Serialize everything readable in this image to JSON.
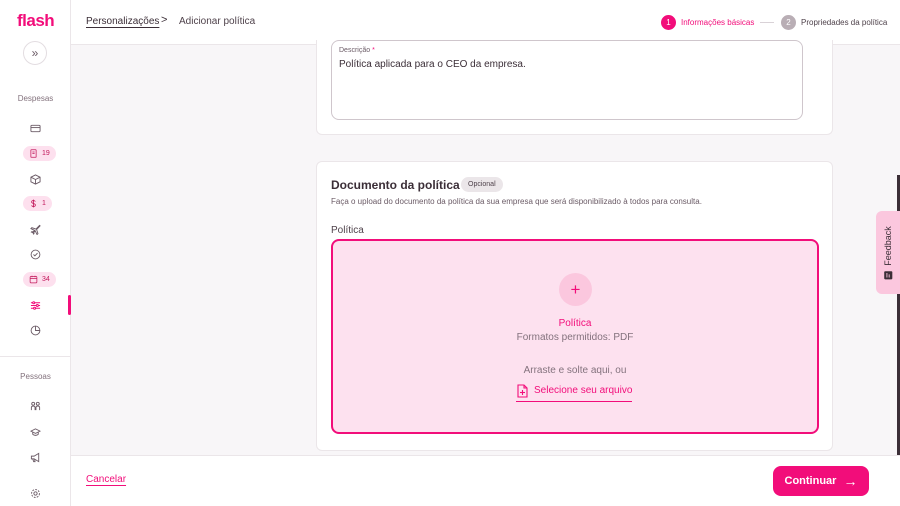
{
  "app": {
    "logo": "flash"
  },
  "sidebar": {
    "expand_glyph": "»",
    "section_expenses": "Despesas",
    "section_people": "Pessoas",
    "badges": {
      "reports": "19",
      "advances": "1",
      "approvals": "34"
    }
  },
  "breadcrumb": {
    "parent": "Personalizações",
    "separator": ">",
    "current": "Adicionar política"
  },
  "stepper": {
    "steps": [
      {
        "number": "1",
        "label": "Informações básicas",
        "active": true
      },
      {
        "number": "2",
        "label": "Propriedades da política",
        "active": false
      }
    ]
  },
  "description_field": {
    "label": "Descrição",
    "required_mark": "*",
    "value": "Política aplicada para o CEO da empresa."
  },
  "document_section": {
    "title": "Documento da política",
    "badge": "Opcional",
    "description": "Faça o upload do documento da política da sua empresa que será disponibilizado à todos para consulta.",
    "field_label": "Política",
    "dropzone": {
      "plus": "+",
      "title": "Política",
      "formats": "Formatos permitidos: PDF",
      "drag_text": "Arraste e solte aqui, ou",
      "select_label": "Selecione seu arquivo"
    }
  },
  "footer": {
    "cancel_label": "Cancelar",
    "continue_label": "Continuar",
    "continue_arrow": "→"
  },
  "feedback": {
    "label": "Feedback"
  },
  "colors": {
    "brand": "#f20d7a",
    "brand_light": "#fde1ef",
    "text": "#3b2e37"
  }
}
